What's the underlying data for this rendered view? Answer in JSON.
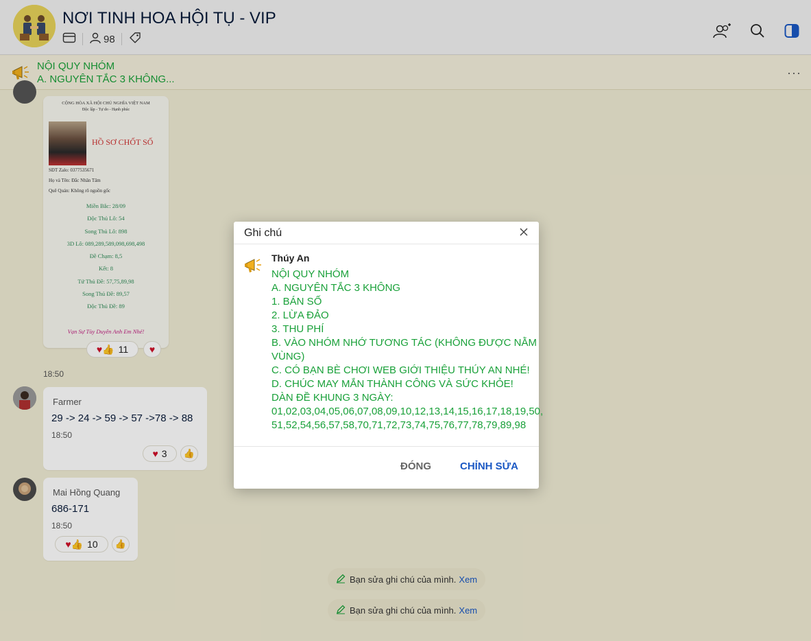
{
  "header": {
    "title": "NƠI TINH HOA HỘI TỤ - VIP",
    "member_count": "98"
  },
  "pinned": {
    "line1": "NỘI QUY NHÓM",
    "line2": "A. NGUYÊN TẮC 3 KHÔNG...",
    "more": "···"
  },
  "image_card": {
    "h1": "CỘNG HÒA XÃ HỘI CHỦ NGHĨA VIỆT NAM",
    "h2": "Độc lập - Tự do - Hạnh phúc",
    "title": "HỒ SƠ CHỐT SỐ",
    "phone": "SĐT Zalo: 0377535671",
    "name": "Họ và Tên:  Đắc Nhân Tâm",
    "hometown": "Quê Quán: Không rõ nguồn gốc",
    "lines": [
      "Miền Bắc: 28/09",
      "Độc Thủ Lô: 54",
      "Song Thủ Lô: 898",
      "3D Lô: 089,289,589,098,698,498",
      "Đề Chạm: 8,5",
      "Kết: 8",
      "Tứ Thủ Đề: 57,75,89,98",
      "Song Thủ Đề: 89,57",
      "Độc Thủ Đề: 89"
    ],
    "footer": "Vạn Sự Tùy Duyên Anh Em Nhé!",
    "reaction_count": "11",
    "time": "18:50"
  },
  "messages": [
    {
      "sender": "Farmer",
      "text": "29 -> 24 -> 59 -> 57 ->78 -> 88",
      "time": "18:50",
      "reaction_count": "3"
    },
    {
      "sender": "Mai Hồng Quang",
      "text": "686-171",
      "time": "18:50",
      "reaction_count": "10"
    }
  ],
  "system_notices": [
    {
      "text": "Bạn sửa ghi chú của mình.",
      "link": "Xem"
    },
    {
      "text": "Bạn sửa ghi chú của mình.",
      "link": "Xem"
    }
  ],
  "modal": {
    "title": "Ghi chú",
    "author": "Thúy An",
    "lines": [
      "NỘI QUY NHÓM",
      "A. NGUYÊN TẮC 3 KHÔNG",
      "1. BÁN SỐ",
      "2. LỪA ĐẢO",
      "3. THU PHÍ",
      "B. VÀO NHÓM NHỚ TƯƠNG TÁC (KHÔNG ĐƯỢC NẰM",
      "VÙNG)",
      "C. CÓ BẠN BÈ CHƠI WEB GIỚI THIỆU THÚY AN NHÉ!",
      "D. CHÚC MAY MẮN THÀNH CÔNG VÀ SỨC KHỎE!",
      "DÀN ĐỀ KHUNG 3 NGÀY:",
      "01,02,03,04,05,06,07,08,09,10,12,13,14,15,16,17,18,19,50,",
      "51,52,54,56,57,58,70,71,72,73,74,75,76,77,78,79,89,98"
    ],
    "close_label": "ĐÓNG",
    "edit_label": "CHỈNH SỬA"
  },
  "colors": {
    "accent": "#1a58c4",
    "note_text": "#1aa13a",
    "chat_bg": "#f0ecd4"
  }
}
